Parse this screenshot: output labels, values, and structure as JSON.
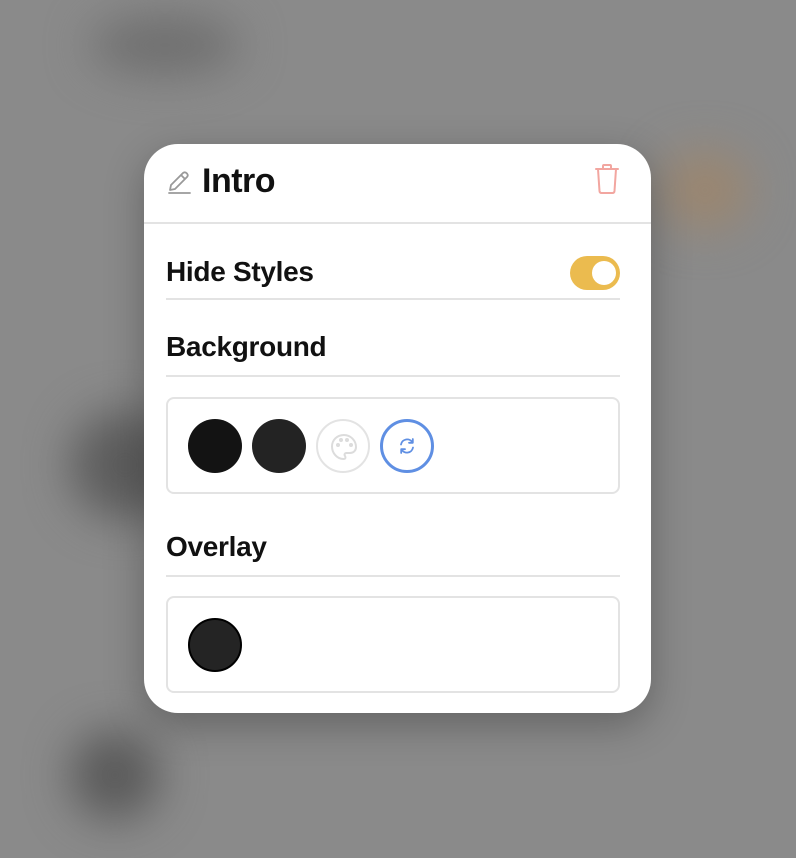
{
  "modal": {
    "title": "Intro",
    "icons": {
      "edit": "pencil-icon",
      "delete": "trash-icon"
    }
  },
  "hide_styles": {
    "label": "Hide Styles",
    "enabled": true,
    "toggle_color": "#ebbb4f"
  },
  "background": {
    "label": "Background",
    "swatches": [
      {
        "name": "black",
        "color": "#131313"
      },
      {
        "name": "dark-gray",
        "color": "#232323"
      }
    ],
    "actions": [
      {
        "name": "custom-color",
        "icon": "palette-icon",
        "color": "#dddddd"
      },
      {
        "name": "refresh",
        "icon": "refresh-icon",
        "color": "#5f8fe3"
      }
    ]
  },
  "overlay": {
    "label": "Overlay",
    "swatches": [
      {
        "name": "dark-gray",
        "color": "#242424"
      }
    ]
  },
  "colors": {
    "delete_icon": "#f2a6a0",
    "edit_icon": "#999999",
    "divider": "#e3e3e3"
  }
}
